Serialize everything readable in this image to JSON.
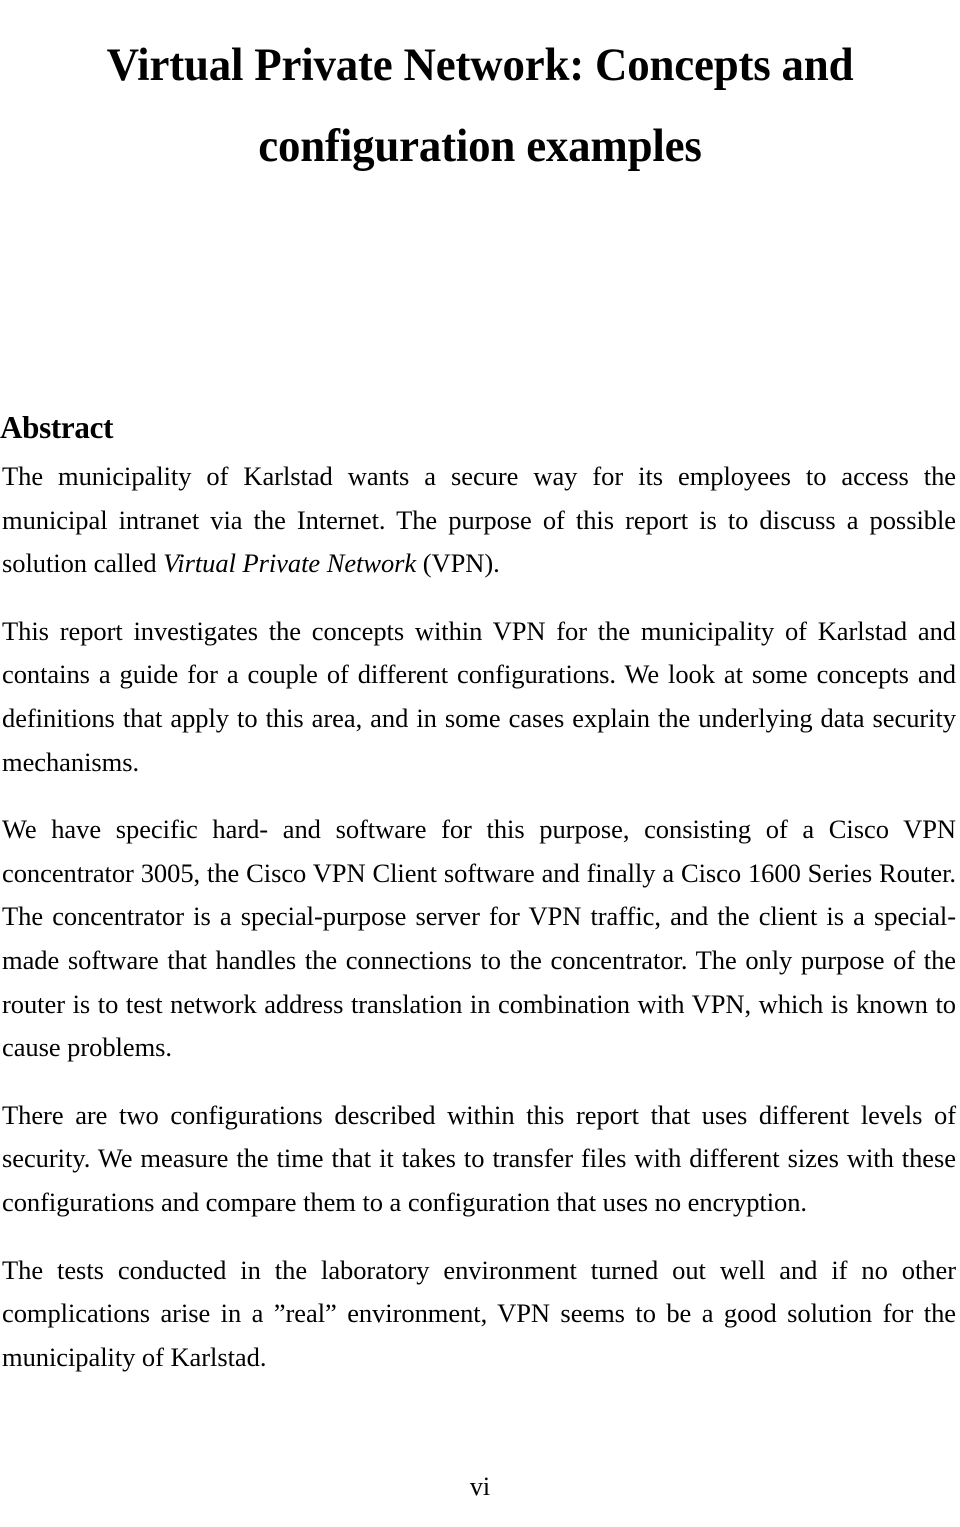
{
  "document": {
    "title_lines": [
      "Virtual Private Network: Concepts and",
      "configuration examples"
    ],
    "section_heading": "Abstract",
    "paragraphs": [
      {
        "id": "p1",
        "runs": [
          {
            "text": "The municipality of Karlstad wants a secure way for its employees to access the municipal intranet via the Internet. The purpose of this report is to discuss a possible solution called ",
            "style": "normal"
          },
          {
            "text": "Virtual Private Network",
            "style": "italic"
          },
          {
            "text": " (VPN).",
            "style": "normal"
          }
        ]
      },
      {
        "id": "p2",
        "runs": [
          {
            "text": "This report investigates the concepts within VPN for the municipality of Karlstad and contains a guide for a couple of different configurations. We look at some concepts and definitions that apply to this area, and in some cases explain the underlying data security mechanisms.",
            "style": "normal"
          }
        ]
      },
      {
        "id": "p3",
        "runs": [
          {
            "text": "We have specific hard- and software for this purpose, consisting of a Cisco VPN concentrator 3005, the Cisco VPN Client software and finally a Cisco 1600 Series Router. The concentrator is a special-purpose server for VPN traffic, and the client is a special-made software that handles the connections to the concentrator. The only purpose of the router is to test network address translation in combination with VPN, which is known to cause problems.",
            "style": "normal"
          }
        ]
      },
      {
        "id": "p4",
        "runs": [
          {
            "text": "There are two configurations described within this report that uses different levels of security. We measure the time that it takes to transfer files with different sizes with these configurations and compare them to a configuration that uses no encryption.",
            "style": "normal"
          }
        ]
      },
      {
        "id": "p5",
        "runs": [
          {
            "text": "The tests conducted in the laboratory environment turned out well and if no other complications arise in a ”real” environment, VPN seems to be a good solution for the municipality of Karlstad.",
            "style": "normal"
          }
        ]
      }
    ],
    "page_number": "vi",
    "colors": {
      "page_background": "#ffffff",
      "text": "#000000"
    }
  }
}
